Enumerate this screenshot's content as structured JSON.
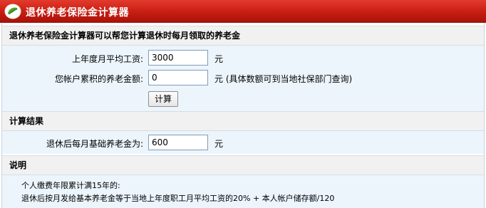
{
  "header": {
    "title": "退休养老保险金计算器",
    "logo_icon": "leaf-circle-icon",
    "colors": {
      "bar": "#c81e12",
      "text": "#ffffff"
    }
  },
  "intro": {
    "heading": "退休养老保险金计算器可以帮您计算退休时每月领取的养老金"
  },
  "form": {
    "avg_salary_label": "上年度月平均工资:",
    "avg_salary_value": "3000",
    "avg_salary_unit": "元",
    "account_label": "您帐户累积的养老金额:",
    "account_value": "0",
    "account_unit": "元 (具体数额可到当地社保部门查询)",
    "calc_button": "计算"
  },
  "result": {
    "heading": "计算结果",
    "label": "退休后每月基础养老金为:",
    "value": "600",
    "unit": "元"
  },
  "explain": {
    "heading": "说明",
    "lines": [
      "个人缴费年限累计满15年的:",
      "退休后按月发给基本养老金等于当地上年度职工月平均工资的20% + 本人帐户储存额/120"
    ]
  }
}
